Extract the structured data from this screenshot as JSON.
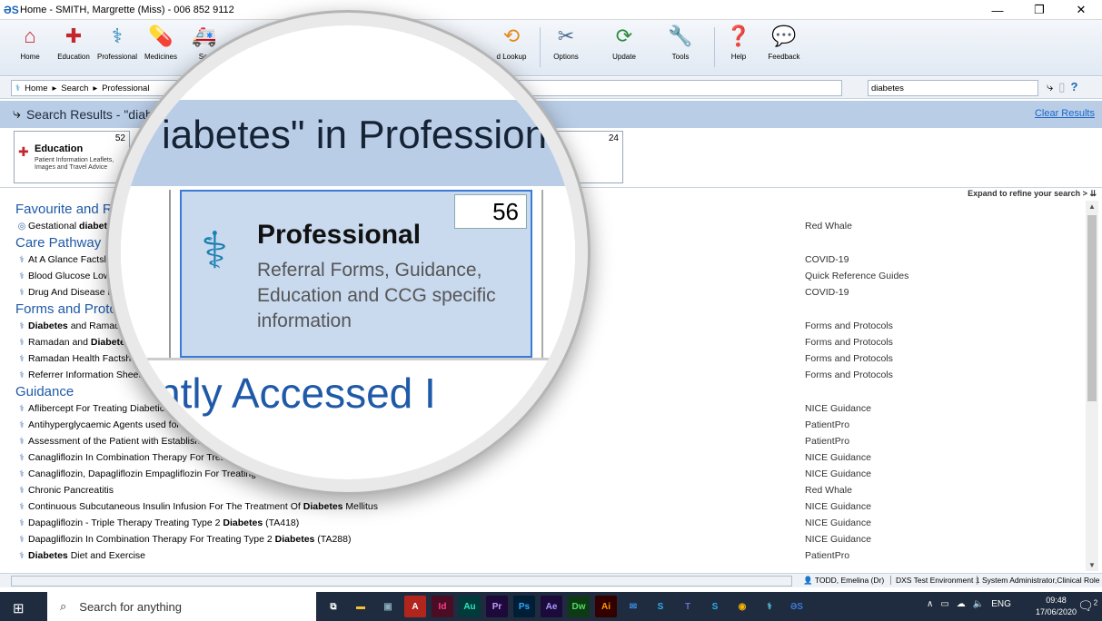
{
  "window": {
    "title": "Home  -  SMITH, Margrette (Miss) - 006 852 9112",
    "logo_icon": "dxs-logo"
  },
  "ribbon": {
    "buttons": [
      {
        "label": "Home",
        "icon": "home-icon"
      },
      {
        "label": "Education",
        "icon": "education-icon"
      },
      {
        "label": "Professional",
        "icon": "caduceus-icon"
      },
      {
        "label": "Medicines",
        "icon": "medicines-icon"
      },
      {
        "label": "Ser",
        "icon": "ambulance-icon"
      },
      {
        "label": "d Lookup",
        "icon": "lookup-icon"
      },
      {
        "label": "Options",
        "icon": "options-icon"
      },
      {
        "label": "Update",
        "icon": "update-icon"
      },
      {
        "label": "Tools",
        "icon": "wrench-icon"
      },
      {
        "label": "Help",
        "icon": "help-icon"
      },
      {
        "label": "Feedback",
        "icon": "feedback-icon"
      }
    ]
  },
  "nav": {
    "breadcrumb": [
      "Home",
      "Search",
      "Professional"
    ],
    "search_value": "diabetes"
  },
  "results": {
    "header": "Search Results - \"diabe",
    "clear_label": "Clear Results",
    "expand_label": "Expand to refine your search >"
  },
  "cards": [
    {
      "name": "Education",
      "count": "52",
      "desc": "Patient Information Leaflets, Images and Travel Advice"
    },
    {
      "name": "",
      "count": "24",
      "desc": ""
    }
  ],
  "list": [
    {
      "type": "section",
      "text": "Favourite and R"
    },
    {
      "type": "row",
      "pre": "Gestational ",
      "bold": "diabet",
      "post": "",
      "source": "Red Whale",
      "icon": "globe-icon"
    },
    {
      "type": "section",
      "text": "Care Pathway"
    },
    {
      "type": "row",
      "pre": "At A Glance Factsl",
      "bold": "",
      "post": "",
      "source": "COVID-19",
      "icon": "caduceus-icon"
    },
    {
      "type": "row",
      "pre": "Blood Glucose Low",
      "bold": "",
      "post": "",
      "source": "Quick Reference Guides",
      "icon": "caduceus-icon"
    },
    {
      "type": "row",
      "pre": "Drug And Disease F",
      "bold": "",
      "post": "",
      "source": "COVID-19",
      "icon": "caduceus-icon"
    },
    {
      "type": "section",
      "text": "Forms and Protc"
    },
    {
      "type": "row",
      "pre": "",
      "bold": "Diabetes",
      "post": " and Ramad.",
      "source": "Forms and Protocols",
      "icon": "caduceus-icon"
    },
    {
      "type": "row",
      "pre": "Ramadan and ",
      "bold": "Diabetes",
      "post": "",
      "source": "Forms and Protocols",
      "icon": "caduceus-icon"
    },
    {
      "type": "row",
      "pre": "Ramadan Health Factshe",
      "bold": "",
      "post": "",
      "source": "Forms and Protocols",
      "icon": "caduceus-icon"
    },
    {
      "type": "row",
      "pre": "Referrer Information Sheet",
      "bold": "",
      "post": "",
      "source": "Forms and Protocols",
      "icon": "caduceus-icon"
    },
    {
      "type": "section",
      "text": "Guidance"
    },
    {
      "type": "row",
      "pre": "Aflibercept For Treating Diabetic M",
      "bold": "",
      "post": "",
      "source": "NICE Guidance",
      "icon": "caduceus-icon"
    },
    {
      "type": "row",
      "pre": "Antihyperglycaemic Agents used for ",
      "bold": "",
      "post": "",
      "source": "PatientPro",
      "icon": "caduceus-icon"
    },
    {
      "type": "row",
      "pre": "Assessment of the Patient with Established",
      "bold": "",
      "post": "",
      "source": "PatientPro",
      "icon": "caduceus-icon"
    },
    {
      "type": "row",
      "pre": "Canagliflozin In Combination Therapy For Treating",
      "bold": "",
      "post": "",
      "source": "NICE Guidance",
      "icon": "caduceus-icon"
    },
    {
      "type": "row",
      "pre": "Canagliflozin, Dapagliflozin  Empagliflozin For Treating Type 2 ",
      "bold": "",
      "post": "",
      "source": "NICE Guidance",
      "icon": "caduceus-icon"
    },
    {
      "type": "row",
      "pre": "Chronic Pancreatitis",
      "bold": "",
      "post": "",
      "source": "Red Whale",
      "icon": "caduceus-icon"
    },
    {
      "type": "row",
      "pre": "Continuous Subcutaneous Insulin Infusion For The Treatment Of ",
      "bold": "Diabetes",
      "post": " Mellitus",
      "source": "NICE Guidance",
      "icon": "caduceus-icon"
    },
    {
      "type": "row",
      "pre": "Dapagliflozin - Triple Therapy Treating Type 2 ",
      "bold": "Diabetes",
      "post": " (TA418)",
      "source": "NICE Guidance",
      "icon": "caduceus-icon"
    },
    {
      "type": "row",
      "pre": "Dapagliflozin In Combination Therapy For Treating Type 2 ",
      "bold": "Diabetes",
      "post": " (TA288)",
      "source": "NICE Guidance",
      "icon": "caduceus-icon"
    },
    {
      "type": "row",
      "pre": "",
      "bold": "Diabetes",
      "post": " Diet and Exercise",
      "source": "PatientPro",
      "icon": "caduceus-icon"
    }
  ],
  "status": {
    "user": "TODD, Emelina (Dr)",
    "environment": "DXS Test Environment 1",
    "role": "System Administrator,Clinical Role"
  },
  "taskbar": {
    "search_placeholder": "Search for anything",
    "apps": [
      "Ai",
      "Id",
      "Au",
      "Pr",
      "Ps",
      "Ae",
      "Dw",
      "Ai"
    ],
    "language": "ENG",
    "time": "09:48",
    "date": "17/06/2020",
    "notification_count": "2"
  },
  "magnifier": {
    "title": "iabetes\" in Professiona",
    "card_count": "56",
    "card_name": "Professional",
    "card_desc": "Referral Forms, Guidance, Education and CCG specific information",
    "recent_label": "ntly Accessed I"
  }
}
